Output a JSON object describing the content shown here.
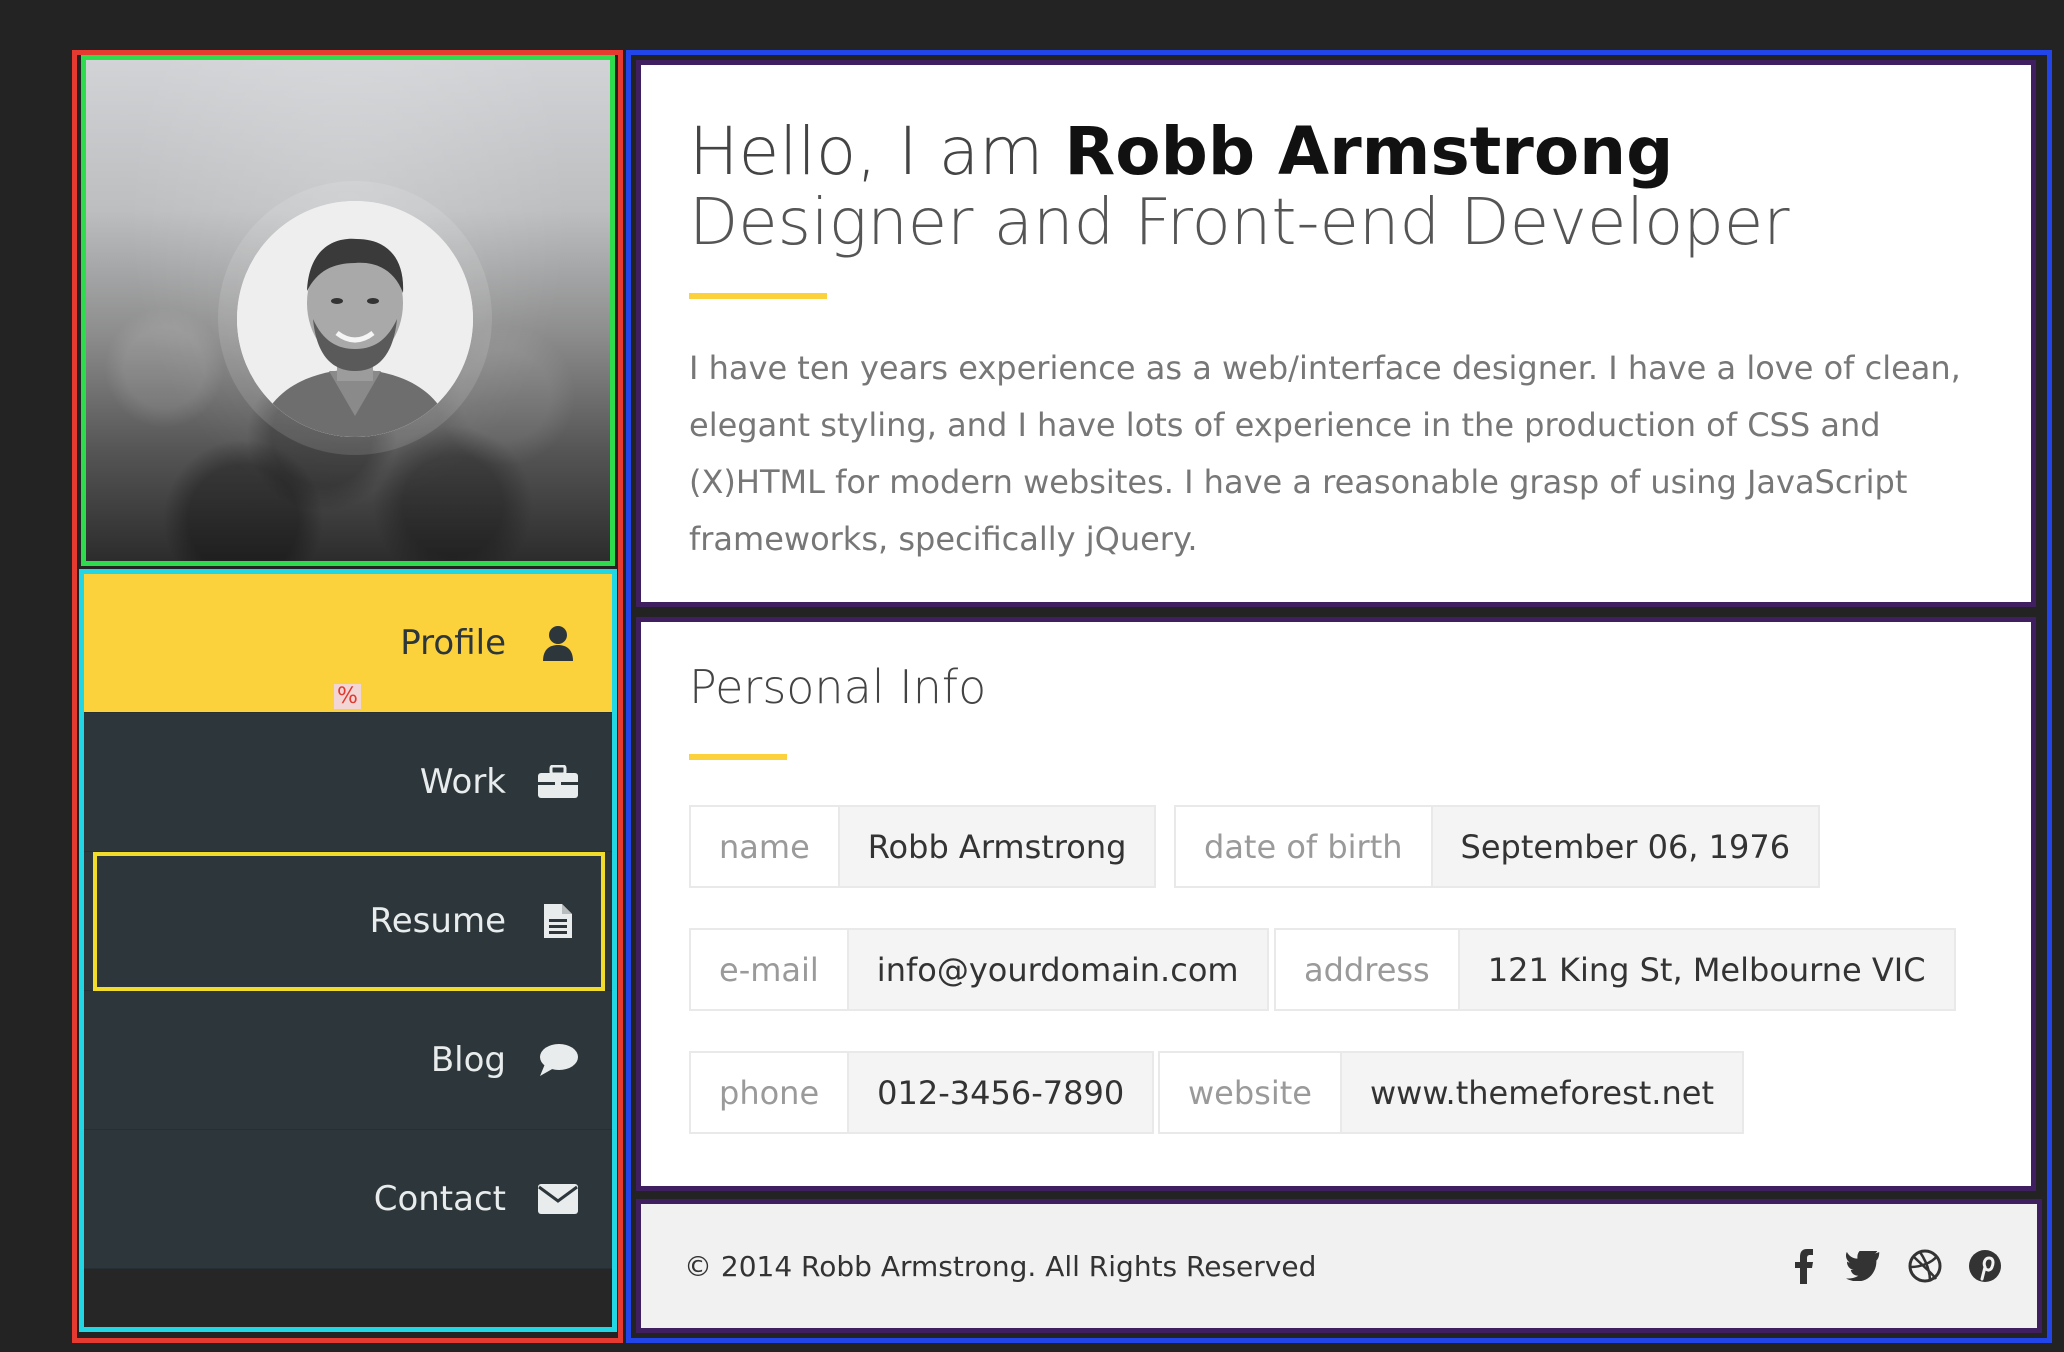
{
  "sidebar": {
    "avatar_alt": "Robb Armstrong portrait",
    "nav": [
      {
        "label": "Profile",
        "icon": "user-icon",
        "active": true
      },
      {
        "label": "Work",
        "icon": "briefcase-icon"
      },
      {
        "label": "Resume",
        "icon": "document-icon"
      },
      {
        "label": "Blog",
        "icon": "comment-icon"
      },
      {
        "label": "Contact",
        "icon": "envelope-icon"
      }
    ],
    "badge": "%"
  },
  "intro": {
    "greeting": "Hello, I am ",
    "name": "Robb Armstrong",
    "role": "Designer and Front-end Developer",
    "bio": "I have ten years experience as a web/interface designer. I have a love of clean, elegant styling, and I have lots of experience in the production of CSS and (X)HTML for modern websites. I have a reasonable grasp of using JavaScript frameworks, specifically jQuery."
  },
  "personal": {
    "title": "Personal Info",
    "fields": [
      {
        "key": "name",
        "value": "Robb Armstrong"
      },
      {
        "key": "date of birth",
        "value": "September 06, 1976"
      },
      {
        "key": "e-mail",
        "value": "info@yourdomain.com"
      },
      {
        "key": "address",
        "value": "121 King St, Melbourne VIC"
      },
      {
        "key": "phone",
        "value": "012-3456-7890"
      },
      {
        "key": "website",
        "value": "www.themeforest.net"
      }
    ]
  },
  "footer": {
    "copyright": "© 2014 Robb Armstrong. All Rights Reserved",
    "social": [
      "facebook-icon",
      "twitter-icon",
      "dribbble-icon",
      "pinterest-icon"
    ]
  },
  "colors": {
    "accent": "#fcd23c",
    "nav_bg": "#2d373b",
    "page_bg": "#232323"
  }
}
